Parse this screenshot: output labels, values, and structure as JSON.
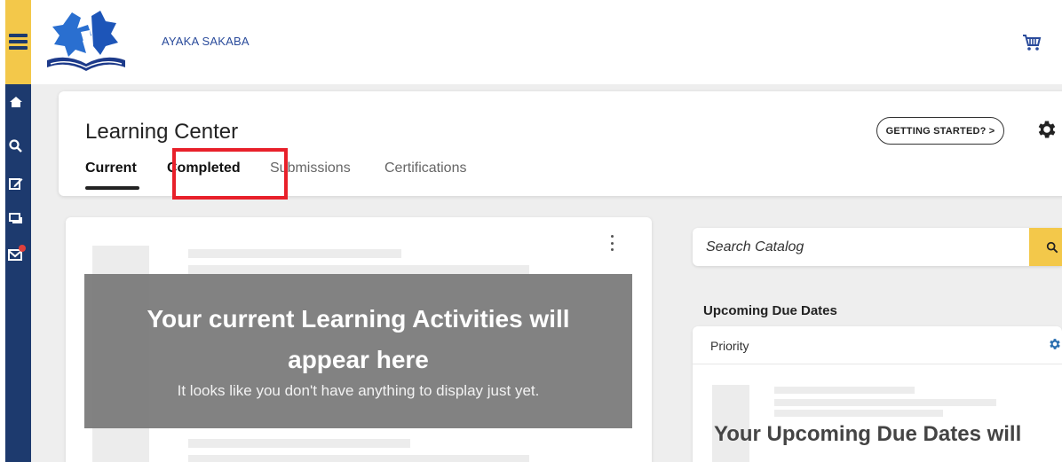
{
  "header": {
    "username": "AYAKA SAKABA"
  },
  "sidebar": {
    "icons": [
      "menu-icon",
      "home-icon",
      "search-icon",
      "edit-icon",
      "chat-icon",
      "mail-icon"
    ]
  },
  "learning_center": {
    "title": "Learning Center",
    "getting_started_label": "GETTING STARTED? >",
    "tabs": [
      {
        "label": "Current",
        "active": true
      },
      {
        "label": "Completed",
        "active": false
      },
      {
        "label": "Submissions",
        "active": false
      },
      {
        "label": "Certifications",
        "active": false
      }
    ]
  },
  "activities": {
    "empty_title": "Your current Learning Activities will appear here",
    "empty_subtitle": "It looks like you don't have anything to display just yet."
  },
  "search": {
    "placeholder": "Search Catalog"
  },
  "due_dates": {
    "heading": "Upcoming Due Dates",
    "priority_label": "Priority",
    "empty_title": "Your Upcoming Due Dates will"
  },
  "colors": {
    "sidebar": "#1d3a6e",
    "accent_yellow": "#f3c84a",
    "highlight_red": "#e8202a",
    "username_blue": "#2a4b9b"
  }
}
